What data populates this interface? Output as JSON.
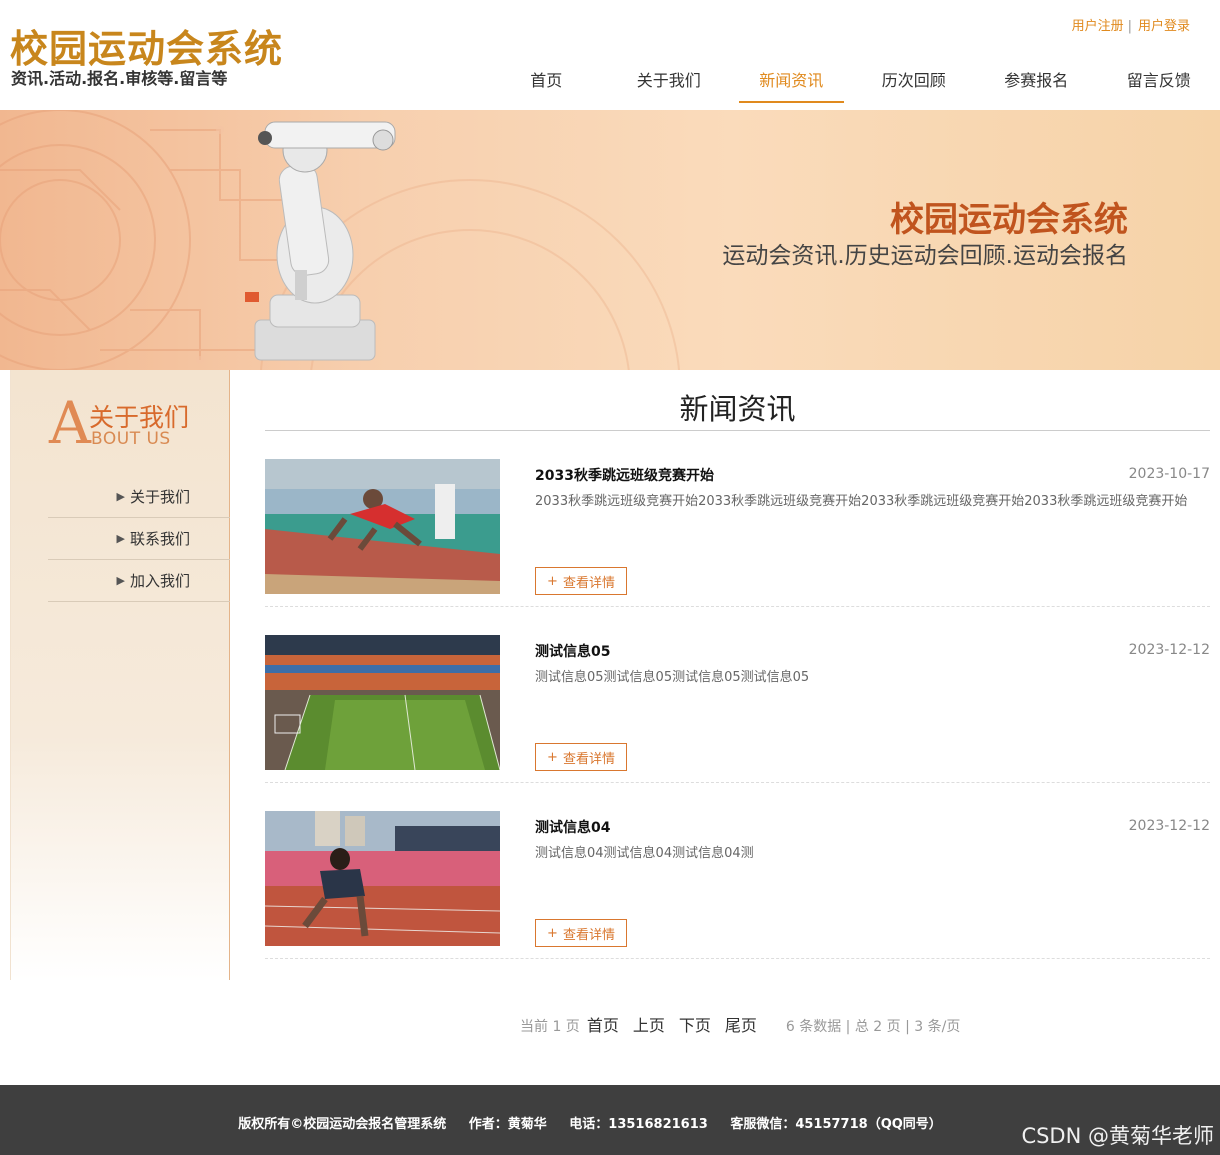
{
  "header": {
    "title": "校园运动会系统",
    "subtitle": "资讯.活动.报名.审核等.留言等",
    "register": "用户注册",
    "sep": "|",
    "login": "用户登录"
  },
  "nav": {
    "items": [
      {
        "label": "首页"
      },
      {
        "label": "关于我们"
      },
      {
        "label": "新闻资讯"
      },
      {
        "label": "历次回顾"
      },
      {
        "label": "参赛报名"
      },
      {
        "label": "留言反馈"
      }
    ],
    "active_index": 2
  },
  "banner": {
    "title": "校园运动会系统",
    "subtitle": "运动会资讯.历史运动会回顾.运动会报名"
  },
  "sidebar": {
    "logo_letter": "A",
    "heading_cn": "关于我们",
    "heading_en": "BOUT US",
    "items": [
      {
        "label": "关于我们"
      },
      {
        "label": "联系我们"
      },
      {
        "label": "加入我们"
      }
    ]
  },
  "main": {
    "title": "新闻资讯",
    "detail_label": "查看详情",
    "detail_plus": "+",
    "news": [
      {
        "title": "2033秋季跳远班级竞赛开始",
        "date": "2023-10-17",
        "desc": "2033秋季跳远班级竞赛开始2033秋季跳远班级竞赛开始2033秋季跳远班级竞赛开始2033秋季跳远班级竞赛开始"
      },
      {
        "title": "测试信息05",
        "date": "2023-12-12",
        "desc": "测试信息05测试信息05测试信息05测试信息05"
      },
      {
        "title": "测试信息04",
        "date": "2023-12-12",
        "desc": "测试信息04测试信息04测试信息04测"
      }
    ]
  },
  "pager": {
    "current": "当前 1 页",
    "first": "首页",
    "prev": "上页",
    "next": "下页",
    "last": "尾页",
    "summary": "6 条数据 | 总 2 页 | 3 条/页"
  },
  "footer": {
    "copyright": "版权所有©校园运动会报名管理系统",
    "author": "作者：黄菊华",
    "phone": "电话：13516821613",
    "wechat": "客服微信：45157718（QQ同号）"
  },
  "watermark": "CSDN @黄菊华老师",
  "colors": {
    "accent": "#e08a1e",
    "banner_title": "#c0541e",
    "footer_bg": "#3f3f3f"
  }
}
